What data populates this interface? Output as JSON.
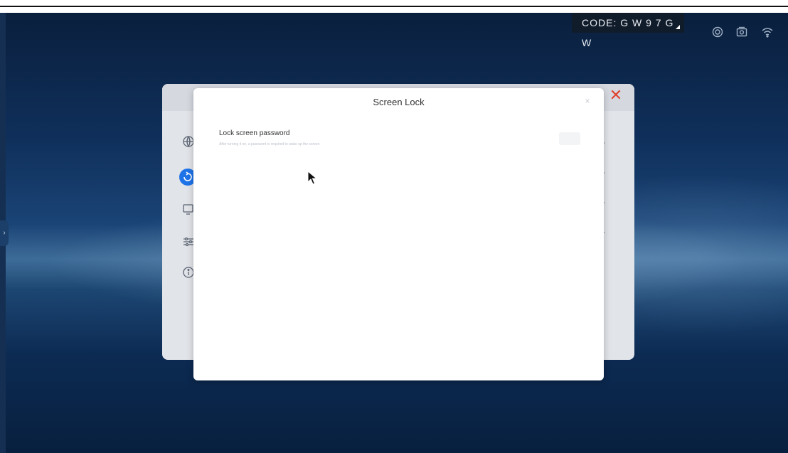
{
  "status_bar": {
    "code_label": "CODE: G W 9 7 G W",
    "icons": [
      "cast-icon",
      "screenshot-icon",
      "wifi-icon"
    ]
  },
  "background_panel": {
    "close_glyph": "✕",
    "sidebar_icons": [
      "globe-icon",
      "refresh-icon",
      "display-icon",
      "sliders-icon",
      "info-icon"
    ]
  },
  "modal": {
    "title": "Screen Lock",
    "close_glyph": "×",
    "setting": {
      "label": "Lock screen password",
      "description": "After turning it on, a password is required to wake up the screen"
    }
  },
  "left_handle": {
    "glyph": "›"
  },
  "colors": {
    "accent": "#1e73e8",
    "close_red": "#e0422f",
    "code_badge_bg": "#111c2b"
  }
}
